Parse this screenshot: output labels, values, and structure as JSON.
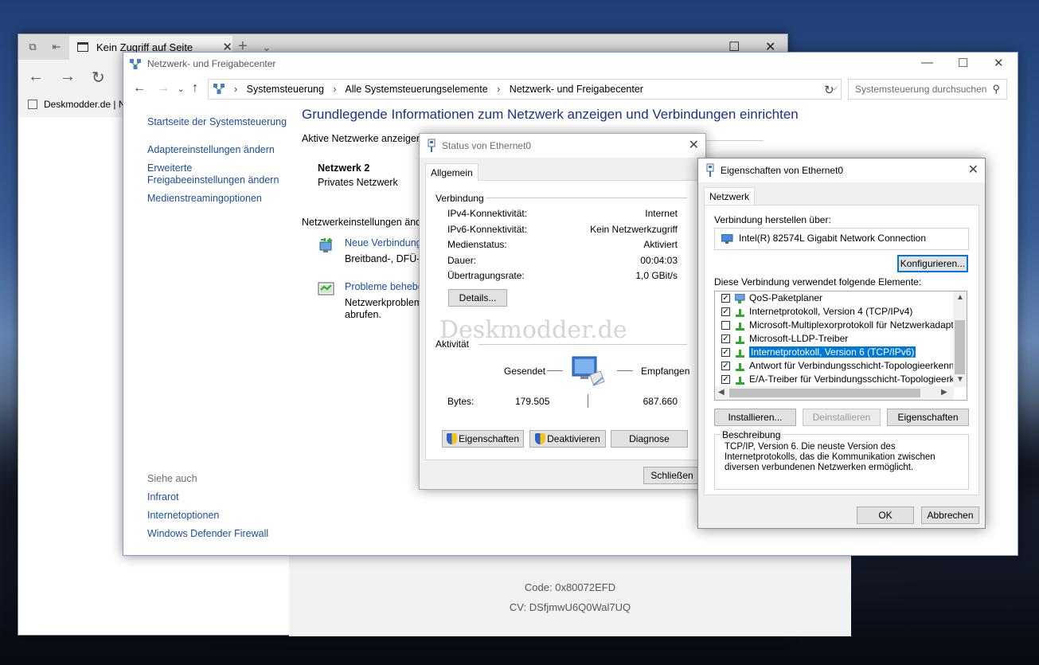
{
  "browser": {
    "tab_title": "Kein Zugriff auf Seite",
    "favorite": "Deskmodder.de | N",
    "code": "Code: 0x80072EFD",
    "cv": "CV: DSfjmwU6Q0Wal7UQ"
  },
  "control_panel": {
    "title": "Netzwerk- und Freigabecenter",
    "breadcrumb": [
      "Systemsteuerung",
      "Alle Systemsteuerungselemente",
      "Netzwerk- und Freigabecenter"
    ],
    "search_placeholder": "Systemsteuerung durchsuchen",
    "left_links": {
      "home": "Startseite der Systemsteuerung",
      "adapter": "Adaptereinstellungen ändern",
      "sharing_1": "Erweiterte",
      "sharing_2": "Freigabeeinstellungen ändern",
      "streaming": "Medienstreamingoptionen"
    },
    "see_also": {
      "heading": "Siehe auch",
      "infrared": "Infrarot",
      "internet_options": "Internetoptionen",
      "firewall": "Windows Defender Firewall"
    },
    "heading": "Grundlegende Informationen zum Netzwerk anzeigen und Verbindungen einrichten",
    "active_networks": "Aktive Netzwerke anzeigen",
    "network_name": "Netzwerk 2",
    "network_type": "Privates Netzwerk",
    "change_settings": "Netzwerkeinstellungen ände",
    "new_connection": "Neue Verbindung",
    "new_connection_desc": "Breitband-, DFÜ- o",
    "troubleshoot": "Probleme behebe",
    "troubleshoot_desc_1": "Netzwerkproblem",
    "troubleshoot_desc_2": "abrufen."
  },
  "status_dialog": {
    "title": "Status von Ethernet0",
    "tab": "Allgemein",
    "connection_group": "Verbindung",
    "rows": [
      {
        "label": "IPv4-Konnektivität:",
        "value": "Internet"
      },
      {
        "label": "IPv6-Konnektivität:",
        "value": "Kein Netzwerkzugriff"
      },
      {
        "label": "Medienstatus:",
        "value": "Aktiviert"
      },
      {
        "label": "Dauer:",
        "value": "00:04:03"
      },
      {
        "label": "Übertragungsrate:",
        "value": "1,0 GBit/s"
      }
    ],
    "details_button": "Details...",
    "activity_group": "Aktivität",
    "sent": "Gesendet",
    "received": "Empfangen",
    "bytes_label": "Bytes:",
    "bytes_sent": "179.505",
    "bytes_received": "687.660",
    "properties_button": "Eigenschaften",
    "disable_button": "Deaktivieren",
    "diagnose_button": "Diagnose",
    "close_button": "Schließen",
    "watermark": "Deskmodder.de"
  },
  "properties_dialog": {
    "title": "Eigenschaften von Ethernet0",
    "tab": "Netzwerk",
    "connect_using": "Verbindung herstellen über:",
    "adapter": "Intel(R) 82574L Gigabit Network Connection",
    "configure_button": "Konfigurieren...",
    "items_label": "Diese Verbindung verwendet folgende Elemente:",
    "items": [
      {
        "label": "QoS-Paketplaner",
        "checked": true
      },
      {
        "label": "Internetprotokoll, Version 4 (TCP/IPv4)",
        "checked": true
      },
      {
        "label": "Microsoft-Multiplexorprotokoll für Netzwerkadapter",
        "checked": false
      },
      {
        "label": "Microsoft-LLDP-Treiber",
        "checked": true
      },
      {
        "label": "Internetprotokoll, Version 6 (TCP/IPv6)",
        "checked": true,
        "selected": true
      },
      {
        "label": "Antwort für Verbindungsschicht-Topologieerkennung",
        "checked": true
      },
      {
        "label": "E/A-Treiber für Verbindungsschicht-Topologieerkennur",
        "checked": true
      }
    ],
    "install_button": "Installieren...",
    "uninstall_button": "Deinstallieren",
    "properties_button": "Eigenschaften",
    "description_title": "Beschreibung",
    "description_text": "TCP/IP, Version 6. Die neuste Version des Internetprotokolls, das die Kommunikation zwischen diversen verbundenen Netzwerken ermöglicht.",
    "ok_button": "OK",
    "cancel_button": "Abbrechen"
  },
  "colors": {
    "accent": "#0078d7",
    "link": "#1a4f9b",
    "heading": "#1e3287"
  }
}
